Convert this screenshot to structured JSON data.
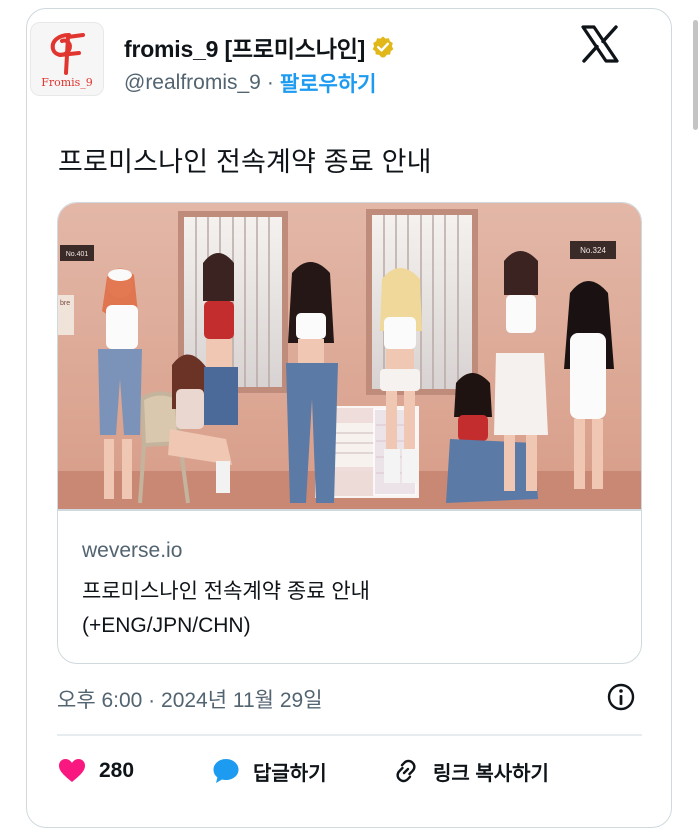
{
  "account": {
    "avatar_text": "Fromis_9",
    "display_name": "fromis_9 [프로미스나인]",
    "handle": "@realfromis_9",
    "separator": "·",
    "follow_label": "팔로우하기"
  },
  "tweet": {
    "text": "프로미스나인 전속계약 종료 안내"
  },
  "link_card": {
    "domain": "weverse.io",
    "title_line1": "프로미스나인 전속계약 종료 안내",
    "title_line2": "(+ENG/JPN/CHN)",
    "sign_left": "No.401",
    "sign_right": "No.324",
    "wall_sign": "bre"
  },
  "meta": {
    "timestamp": "오후 6:00 · 2024년 11월 29일"
  },
  "actions": {
    "like_count": "280",
    "reply_label": "답글하기",
    "copy_link_label": "링크 복사하기"
  },
  "colors": {
    "accent": "#1d9bf0",
    "like": "#f91880",
    "verified": "#e2b719",
    "brand": "#e1352f"
  },
  "icons": [
    "verified-badge-icon",
    "x-logo-icon",
    "info-icon",
    "heart-icon",
    "speech-bubble-icon",
    "link-icon"
  ]
}
